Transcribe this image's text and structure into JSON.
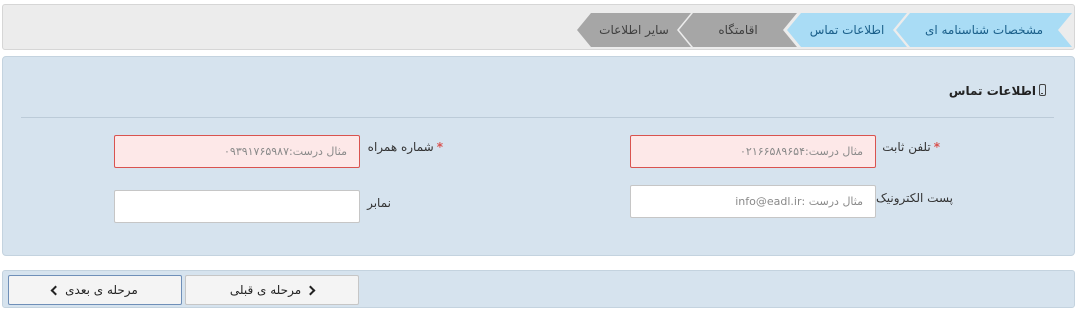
{
  "steps": [
    {
      "label": "مشخصات شناسنامه ای",
      "state": "active"
    },
    {
      "label": "اطلاعات تماس",
      "state": "active"
    },
    {
      "label": "اقامتگاه",
      "state": "inactive"
    },
    {
      "label": "سایر اطلاعات",
      "state": "inactive"
    }
  ],
  "section": {
    "title": "اطلاعات تماس",
    "icon": "mobile-phone-icon"
  },
  "fields": {
    "landline": {
      "label": "تلفن ثابت",
      "required": "*",
      "placeholder": "مثال درست:۰۲۱۶۶۵۸۹۶۵۴",
      "value": ""
    },
    "mobile": {
      "label": "شماره همراه",
      "required": "*",
      "placeholder": "مثال درست:۰۹۳۹۱۷۶۵۹۸۷",
      "value": ""
    },
    "email": {
      "label": "پست الکترونیک",
      "placeholder": "مثال درست :info@eadl.ir",
      "value": ""
    },
    "fax": {
      "label": "نمابر",
      "placeholder": "",
      "value": ""
    }
  },
  "nav": {
    "prev_label": "مرحله ی قبلی",
    "next_label": "مرحله ی بعدی"
  },
  "colors": {
    "active_step": "#a9dcf5",
    "inactive_step": "#a6a6a6",
    "panel_bg": "#d6e3ee",
    "invalid_field_bg": "#fde8e8",
    "required_mark": "#d9534f"
  }
}
